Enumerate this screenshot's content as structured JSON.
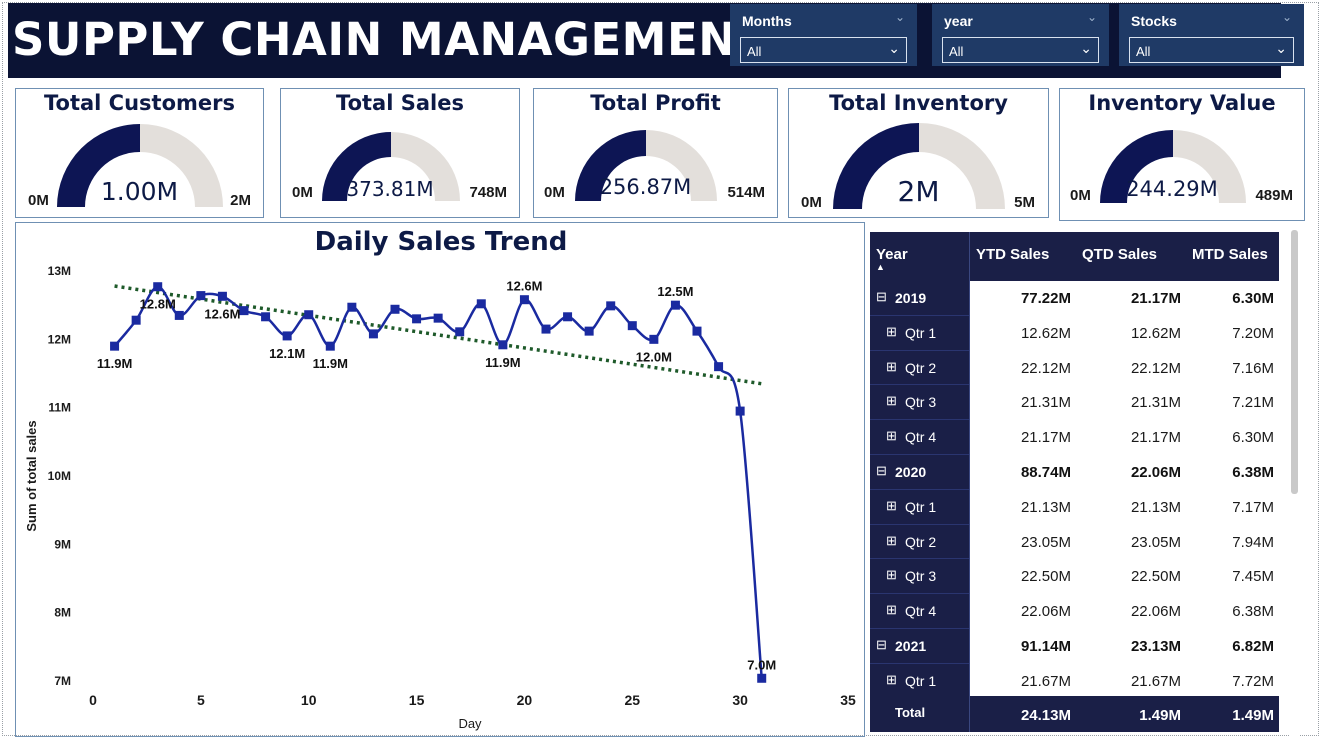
{
  "title": "SUPPLY CHAIN MANAGEMENT",
  "slicers": [
    {
      "label": "Months",
      "value": "All"
    },
    {
      "label": "year",
      "value": "All"
    },
    {
      "label": "Stocks",
      "value": "All"
    }
  ],
  "kpis": [
    {
      "title": "Total Customers",
      "value": "1.00M",
      "min": "0M",
      "max": "2M",
      "fill_fraction": 0.5
    },
    {
      "title": "Total Sales",
      "value": "373.81M",
      "min": "0M",
      "max": "748M",
      "fill_fraction": 0.5
    },
    {
      "title": "Total Profit",
      "value": "256.87M",
      "min": "0M",
      "max": "514M",
      "fill_fraction": 0.5
    },
    {
      "title": "Total Inventory",
      "value": "2M",
      "min": "0M",
      "max": "5M",
      "fill_fraction": 0.5
    },
    {
      "title": "Inventory Value",
      "value": "244.29M",
      "min": "0M",
      "max": "489M",
      "fill_fraction": 0.5
    }
  ],
  "colors": {
    "header_bg": "#0b1334",
    "slicer_bg": "#1f3a66",
    "gauge_fill": "#0d1554",
    "gauge_track": "#e3dfdb",
    "line": "#1a2aa0",
    "trend": "#1e5a2a",
    "table_dark": "#1a1f47"
  },
  "chart_data": {
    "type": "line",
    "title": "Daily Sales Trend",
    "xlabel": "Day",
    "ylabel": "Sum of total sales",
    "xlim": [
      0,
      35
    ],
    "ylim": [
      7,
      13
    ],
    "x_ticks": [
      0,
      5,
      10,
      15,
      20,
      25,
      30,
      35
    ],
    "y_ticks": [
      7,
      8,
      9,
      10,
      11,
      12,
      13
    ],
    "y_tick_labels": [
      "7M",
      "8M",
      "9M",
      "10M",
      "11M",
      "12M",
      "13M"
    ],
    "series": [
      {
        "x": [
          1,
          2,
          3,
          4,
          5,
          6,
          7,
          8,
          9,
          10,
          11,
          12,
          13,
          14,
          15,
          16,
          17,
          18,
          19,
          20,
          21,
          22,
          23,
          24,
          25,
          26,
          27,
          28,
          29,
          30,
          31
        ],
        "values": [
          11.9,
          12.28,
          12.77,
          12.35,
          12.64,
          12.63,
          12.42,
          12.33,
          12.05,
          12.36,
          11.9,
          12.47,
          12.08,
          12.44,
          12.3,
          12.31,
          12.11,
          12.52,
          11.92,
          12.58,
          12.15,
          12.33,
          12.12,
          12.49,
          12.2,
          12.0,
          12.5,
          12.12,
          11.6,
          10.95,
          7.04
        ]
      }
    ],
    "trendline": {
      "x": [
        1,
        31
      ],
      "values": [
        12.78,
        11.35
      ]
    },
    "data_labels": [
      {
        "x": 1,
        "y": 11.9,
        "text": "11.9M",
        "pos": "below"
      },
      {
        "x": 3,
        "y": 12.77,
        "text": "12.8M",
        "pos": "below"
      },
      {
        "x": 6,
        "y": 12.63,
        "text": "12.6M",
        "pos": "below"
      },
      {
        "x": 9,
        "y": 12.05,
        "text": "12.1M",
        "pos": "below"
      },
      {
        "x": 11,
        "y": 11.9,
        "text": "11.9M",
        "pos": "below"
      },
      {
        "x": 19,
        "y": 11.92,
        "text": "11.9M",
        "pos": "below"
      },
      {
        "x": 20,
        "y": 12.58,
        "text": "12.6M",
        "pos": "above"
      },
      {
        "x": 26,
        "y": 12.0,
        "text": "12.0M",
        "pos": "below"
      },
      {
        "x": 27,
        "y": 12.5,
        "text": "12.5M",
        "pos": "above"
      },
      {
        "x": 31,
        "y": 7.04,
        "text": "7.0M",
        "pos": "above"
      }
    ]
  },
  "table": {
    "headers": {
      "year": "Year",
      "ytd": "YTD Sales",
      "qtd": "QTD Sales",
      "mtd": "MTD Sales"
    },
    "rows": [
      {
        "label": "2019",
        "level": "year",
        "ytd": "77.22M",
        "qtd": "21.17M",
        "mtd": "6.30M"
      },
      {
        "label": "Qtr 1",
        "level": "qtr",
        "ytd": "12.62M",
        "qtd": "12.62M",
        "mtd": "7.20M"
      },
      {
        "label": "Qtr 2",
        "level": "qtr",
        "ytd": "22.12M",
        "qtd": "22.12M",
        "mtd": "7.16M"
      },
      {
        "label": "Qtr 3",
        "level": "qtr",
        "ytd": "21.31M",
        "qtd": "21.31M",
        "mtd": "7.21M"
      },
      {
        "label": "Qtr 4",
        "level": "qtr",
        "ytd": "21.17M",
        "qtd": "21.17M",
        "mtd": "6.30M"
      },
      {
        "label": "2020",
        "level": "year",
        "ytd": "88.74M",
        "qtd": "22.06M",
        "mtd": "6.38M"
      },
      {
        "label": "Qtr 1",
        "level": "qtr",
        "ytd": "21.13M",
        "qtd": "21.13M",
        "mtd": "7.17M"
      },
      {
        "label": "Qtr 2",
        "level": "qtr",
        "ytd": "23.05M",
        "qtd": "23.05M",
        "mtd": "7.94M"
      },
      {
        "label": "Qtr 3",
        "level": "qtr",
        "ytd": "22.50M",
        "qtd": "22.50M",
        "mtd": "7.45M"
      },
      {
        "label": "Qtr 4",
        "level": "qtr",
        "ytd": "22.06M",
        "qtd": "22.06M",
        "mtd": "6.38M"
      },
      {
        "label": "2021",
        "level": "year",
        "ytd": "91.14M",
        "qtd": "23.13M",
        "mtd": "6.82M"
      },
      {
        "label": "Qtr 1",
        "level": "qtr",
        "ytd": "21.67M",
        "qtd": "21.67M",
        "mtd": "7.72M"
      }
    ],
    "total": {
      "label": "Total",
      "ytd": "24.13M",
      "qtd": "1.49M",
      "mtd": "1.49M"
    },
    "icons": {
      "collapse": "⊟",
      "expand": "⊞",
      "sort": "▲"
    }
  }
}
